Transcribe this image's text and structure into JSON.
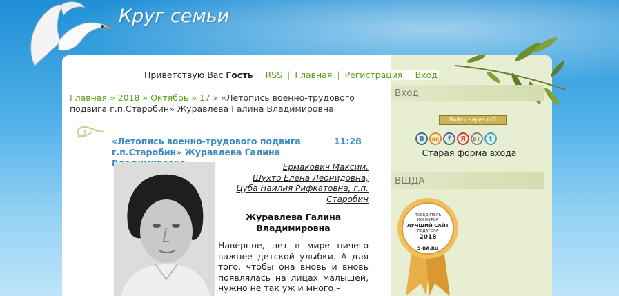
{
  "site": {
    "title": "Круг семьи"
  },
  "nav": {
    "greeting_prefix": "Приветствую Вас",
    "greeting_user": "Гость",
    "items": [
      "RSS",
      "Главная",
      "Регистрация",
      "Вход"
    ]
  },
  "breadcrumb": {
    "items": [
      "Главная",
      "2018",
      "Октябрь",
      "17"
    ],
    "current": "«Летопись военно-трудового подвига г.п.Старобин» Журавлева Галина Владимировна"
  },
  "entry": {
    "title": "«Летопись военно-трудового подвига г.п.Старобин» Журавлева Галина Владимировна",
    "time": "11:28",
    "authors": [
      "Ермакович Максим,",
      "Шухто Елена Леонидовна,",
      "Цуба Наилия Рифкатовна, г.п. Старобин"
    ],
    "person": "Журавлева Галина Владимировна",
    "text": "Наверное, нет в мире ничего важнее детской улыбки. А для того, чтобы она вновь и вновь появлялась на лицах малышей, нужно не так уж и много –"
  },
  "sidebar": {
    "login_title": "Вход",
    "uid_button": "Войти через uID",
    "social_icons": [
      "vk-icon",
      "odnoklassniki-icon",
      "facebook-icon",
      "yandex-icon",
      "google-plus-icon",
      "twitter-icon"
    ],
    "social_glyphs": [
      "В",
      "ок",
      "f",
      "Я",
      "8+",
      "t"
    ],
    "old_form_link": "Старая форма входа",
    "block2_title": "ВШДА",
    "medal": {
      "line1": "ПОБЕДИТЕЛЬ",
      "line2": "КОНКУРСА",
      "line3": "ЛУЧШИЙ САЙТ",
      "line4": "ПЕДАГОГА",
      "year": "2018",
      "site": "S-BA.RU"
    }
  },
  "colors": {
    "link": "#5aa017",
    "title": "#3a88c6",
    "sidebar": "#e8eed1"
  }
}
